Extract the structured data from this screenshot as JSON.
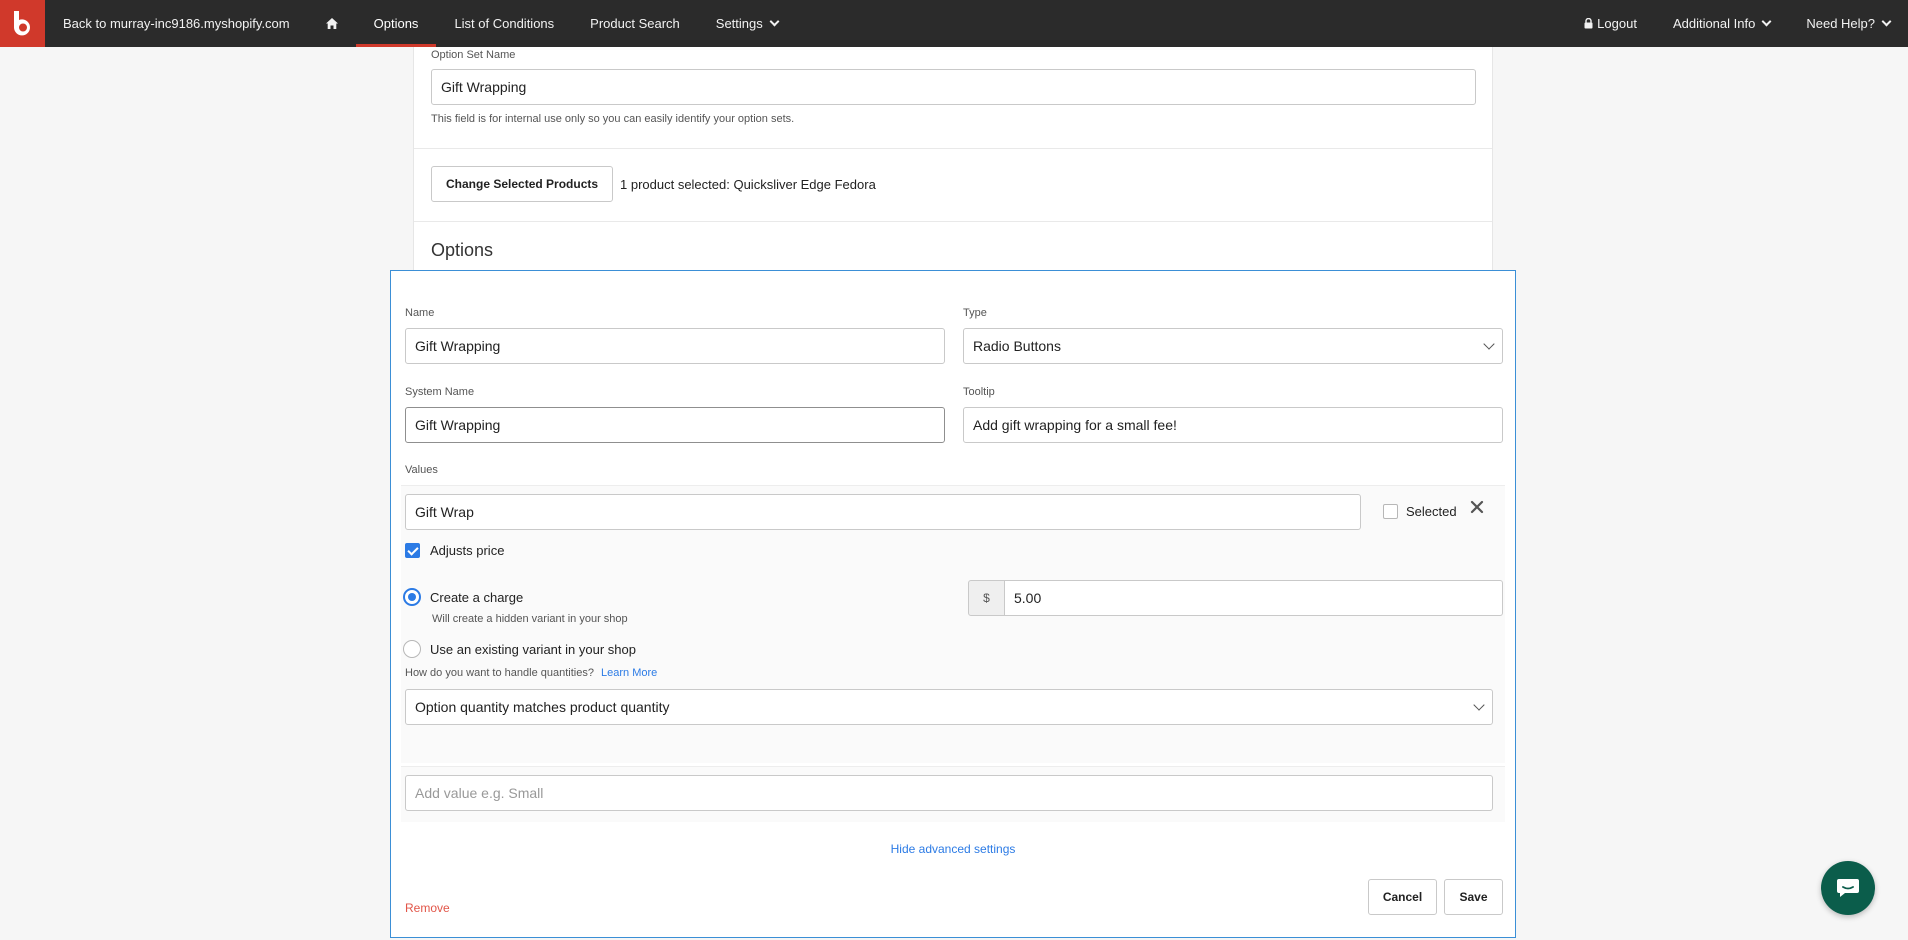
{
  "nav": {
    "back_link": "Back to murray-inc9186.myshopify.com",
    "options": "Options",
    "list_of_conditions": "List of Conditions",
    "product_search": "Product Search",
    "settings": "Settings",
    "logout": "Logout",
    "additional_info": "Additional Info",
    "need_help": "Need Help?"
  },
  "option_set": {
    "name_label": "Option Set Name",
    "name_value": "Gift Wrapping",
    "name_hint": "This field is for internal use only so you can easily identify your option sets.",
    "change_products_button": "Change Selected Products",
    "products_selected": "1 product selected: Quicksliver Edge Fedora",
    "options_heading": "Options"
  },
  "option": {
    "name_label": "Name",
    "name_value": "Gift Wrapping",
    "type_label": "Type",
    "type_value": "Radio Buttons",
    "system_name_label": "System Name",
    "system_name_value": "Gift Wrapping",
    "tooltip_label": "Tooltip",
    "tooltip_value": "Add gift wrapping for a small fee!",
    "values_label": "Values",
    "value": {
      "text": "Gift Wrap",
      "selected_label": "Selected",
      "selected": false,
      "adjusts_price_label": "Adjusts price",
      "adjusts_price": true,
      "create_charge_label": "Create a charge",
      "create_charge_hint": "Will create a hidden variant in your shop",
      "existing_variant_label": "Use an existing variant in your shop",
      "currency_symbol": "$",
      "price": "5.00",
      "quantities_question": "How do you want to handle quantities?",
      "learn_more": "Learn More",
      "quantity_mode": "Option quantity matches product quantity"
    },
    "add_value_placeholder": "Add value e.g. Small",
    "hide_advanced": "Hide advanced settings",
    "remove": "Remove",
    "cancel": "Cancel",
    "save": "Save"
  },
  "colors": {
    "brand": "#d0392b",
    "nav_bg": "#2b2b2b",
    "accent": "#2c7be5",
    "danger": "#e25548",
    "chat": "#0b5d4b"
  }
}
